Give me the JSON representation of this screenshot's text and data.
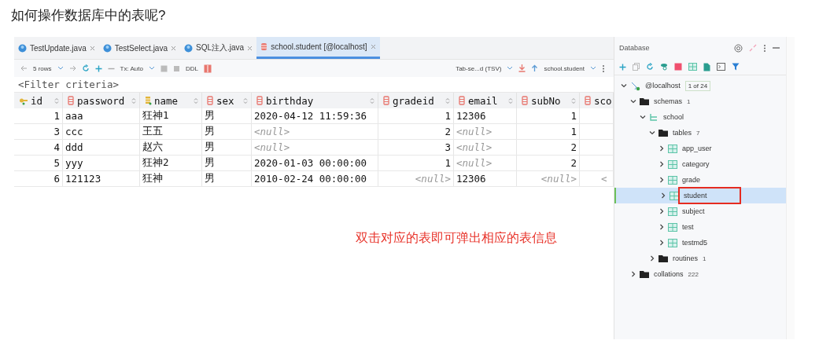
{
  "page": {
    "heading": "如何操作数据库中的表呢?",
    "note": "双击对应的表即可弹出相应的表信息"
  },
  "editor_tabs": [
    {
      "label": "TestUpdate.java",
      "kind": "java",
      "selected": false
    },
    {
      "label": "TestSelect.java",
      "kind": "java",
      "selected": false
    },
    {
      "label": "SQL注入.java",
      "kind": "java",
      "selected": false
    },
    {
      "label": "school.student [@localhost]",
      "kind": "table",
      "selected": true
    }
  ],
  "toolbar": {
    "rows": "5 rows",
    "tx": "Tx: Auto",
    "ddl": "DDL",
    "format": "Tab-se...d (TSV)",
    "target": "school.student"
  },
  "filter": {
    "placeholder": "<Filter criteria>"
  },
  "grid": {
    "columns": [
      {
        "name": "id",
        "kind": "key",
        "numeric": true
      },
      {
        "name": "password",
        "kind": "column",
        "numeric": false
      },
      {
        "name": "name",
        "kind": "index",
        "numeric": false
      },
      {
        "name": "sex",
        "kind": "column"
      },
      {
        "name": "birthday",
        "kind": "column",
        "numeric": false
      },
      {
        "name": "gradeid",
        "kind": "column",
        "numeric": true
      },
      {
        "name": "email",
        "kind": "column",
        "numeric": false
      },
      {
        "name": "subNo",
        "kind": "column",
        "numeric": true
      },
      {
        "name": "sco",
        "kind": "column",
        "numeric": false
      }
    ],
    "rows": [
      [
        {
          "text": "1",
          "null": false
        },
        {
          "text": "aaa",
          "null": false
        },
        {
          "text": "狂神1",
          "null": false
        },
        {
          "text": "男",
          "null": false
        },
        {
          "text": "2020-04-12 11:59:36",
          "null": false
        },
        {
          "text": "1",
          "null": false
        },
        {
          "text": "12306",
          "null": false
        },
        {
          "text": "1",
          "null": false
        }
      ],
      [
        {
          "text": "3",
          "null": false
        },
        {
          "text": "ccc",
          "null": false
        },
        {
          "text": "王五",
          "null": false
        },
        {
          "text": "男",
          "null": false
        },
        {
          "text": "<null>",
          "null": true
        },
        {
          "text": "2",
          "null": false
        },
        {
          "text": "<null>",
          "null": true
        },
        {
          "text": "1",
          "null": false
        }
      ],
      [
        {
          "text": "4",
          "null": false
        },
        {
          "text": "ddd",
          "null": false
        },
        {
          "text": "赵六",
          "null": false
        },
        {
          "text": "男",
          "null": false
        },
        {
          "text": "<null>",
          "null": true
        },
        {
          "text": "3",
          "null": false
        },
        {
          "text": "<null>",
          "null": true
        },
        {
          "text": "2",
          "null": false
        }
      ],
      [
        {
          "text": "5",
          "null": false
        },
        {
          "text": "yyy",
          "null": false
        },
        {
          "text": "狂神2",
          "null": false
        },
        {
          "text": "男",
          "null": false
        },
        {
          "text": "2020-01-03 00:00:00",
          "null": false
        },
        {
          "text": "1",
          "null": false
        },
        {
          "text": "<null>",
          "null": true
        },
        {
          "text": "2",
          "null": false
        }
      ],
      [
        {
          "text": "6",
          "null": false
        },
        {
          "text": "121123",
          "null": false
        },
        {
          "text": "狂神",
          "null": false
        },
        {
          "text": "男",
          "null": false
        },
        {
          "text": "2010-02-24 00:00:00",
          "null": false
        },
        {
          "text": "<null>",
          "null": true
        },
        {
          "text": "12306",
          "null": false
        },
        {
          "text": "<null>",
          "null": true
        },
        {
          "text": "<",
          "null": true
        }
      ]
    ]
  },
  "sidebar": {
    "title": "Database",
    "tree": [
      {
        "label": "@localhost",
        "badge": "1 of 24",
        "kind": "host",
        "expanded": true,
        "selected": false,
        "children": [
          {
            "label": "schemas",
            "count": "1",
            "kind": "folder",
            "expanded": true,
            "selected": false,
            "children": [
              {
                "label": "school",
                "kind": "schema",
                "expanded": true,
                "selected": false,
                "children": [
                  {
                    "label": "tables",
                    "count": "7",
                    "kind": "folder",
                    "expanded": true,
                    "selected": false,
                    "children": [
                      {
                        "label": "app_user",
                        "kind": "table",
                        "expanded": false,
                        "selected": false
                      },
                      {
                        "label": "category",
                        "kind": "table",
                        "expanded": false,
                        "selected": false
                      },
                      {
                        "label": "grade",
                        "kind": "table",
                        "expanded": false,
                        "selected": false
                      },
                      {
                        "label": "student",
                        "kind": "table",
                        "expanded": false,
                        "selected": true
                      },
                      {
                        "label": "subject",
                        "kind": "table",
                        "expanded": false,
                        "selected": false
                      },
                      {
                        "label": "test",
                        "kind": "table",
                        "expanded": false,
                        "selected": false
                      },
                      {
                        "label": "testmd5",
                        "kind": "table",
                        "expanded": false,
                        "selected": false
                      }
                    ]
                  },
                  {
                    "label": "routines",
                    "count": "1",
                    "kind": "folder",
                    "expanded": false,
                    "selected": false
                  }
                ]
              }
            ]
          },
          {
            "label": "collations",
            "count": "222",
            "kind": "folder",
            "expanded": false,
            "selected": false
          }
        ]
      }
    ]
  }
}
